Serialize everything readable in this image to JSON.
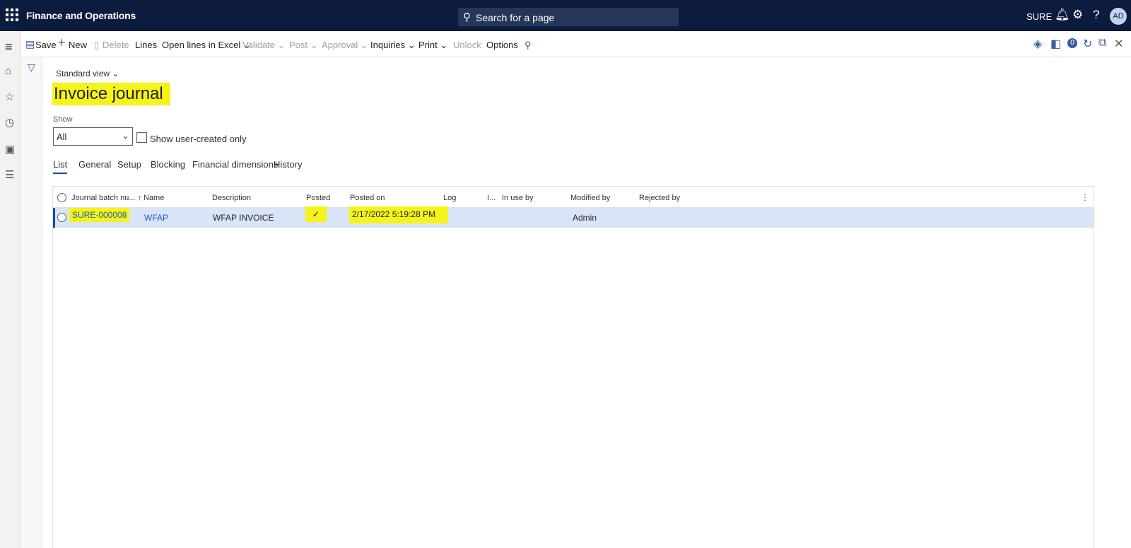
{
  "topbar": {
    "app_title": "Finance and Operations",
    "search_text": "Search for a page",
    "company": "SURE",
    "avatar_initials": "AD",
    "icons": [
      "waffle-icon",
      "search-icon",
      "bell-icon",
      "gear-icon",
      "help-icon"
    ]
  },
  "leftnav": {
    "icons": [
      "hamburger-icon",
      "home-icon",
      "star-icon",
      "clock-icon",
      "workspace-icon",
      "list-icon"
    ]
  },
  "actionbar": {
    "save": "Save",
    "new": "New",
    "delete": "Delete",
    "lines": "Lines",
    "open_lines_excel": "Open lines in Excel",
    "validate": "Validate",
    "post": "Post",
    "approval": "Approval",
    "inquiries": "Inquiries",
    "print": "Print",
    "unlock": "Unlock",
    "options": "Options",
    "notification_count": "0"
  },
  "page": {
    "view": "Standard view",
    "title": "Invoice journal",
    "show_label": "Show",
    "show_value": "All",
    "show_user_created": "Show user-created only"
  },
  "tabs": [
    "List",
    "General",
    "Setup",
    "Blocking",
    "Financial dimensions",
    "History"
  ],
  "grid": {
    "columns": [
      "Journal batch nu...",
      "Name",
      "Description",
      "Posted",
      "Posted on",
      "Log",
      "I...",
      "In use by",
      "Modified by",
      "Rejected by"
    ],
    "rows": [
      {
        "journal_batch": "SURE-000008",
        "name": "WFAP",
        "description": "WFAP INVOICE",
        "posted": "✓",
        "posted_on": "2/17/2022 5:19:28 PM",
        "log": "",
        "in_use_by": "",
        "modified_by": "Admin",
        "rejected_by": ""
      }
    ]
  },
  "colors": {
    "topbar": "#0d1b3e",
    "highlight": "#f5f31a",
    "selected_row": "#d9e4f7",
    "accent": "#0f4ea8"
  }
}
